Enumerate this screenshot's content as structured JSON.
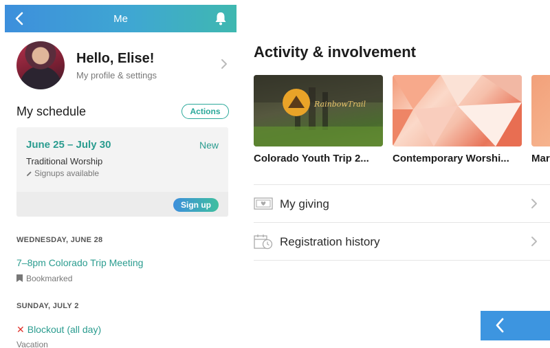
{
  "header": {
    "title": "Me"
  },
  "profile": {
    "greeting": "Hello, Elise!",
    "subtitle": "My profile & settings"
  },
  "schedule": {
    "title": "My schedule",
    "actions_label": "Actions",
    "card": {
      "dates": "June 25 – July 30",
      "badge": "New",
      "service": "Traditional Worship",
      "signups": "Signups available",
      "signup_button": "Sign up"
    },
    "days": [
      {
        "heading": "WEDNESDAY, JUNE 28",
        "event": "7–8pm Colorado Trip Meeting",
        "note": "Bookmarked"
      },
      {
        "heading": "SUNDAY, JULY 2",
        "event": "Blockout (all day)",
        "note": "Vacation"
      }
    ]
  },
  "activity": {
    "title": "Activity & involvement",
    "items": [
      {
        "label": "Colorado Youth Trip 2...",
        "logo_text": "RainbowTrail"
      },
      {
        "label": "Contemporary Worshi..."
      },
      {
        "label": "Mar"
      }
    ],
    "rows": [
      {
        "label": "My giving",
        "icon": "money-icon"
      },
      {
        "label": "Registration history",
        "icon": "calendar-clock-icon"
      }
    ]
  },
  "colors": {
    "accent_teal": "#2a9c8f",
    "header_blue": "#3d8fdc",
    "blockout_red": "#e0322b"
  }
}
